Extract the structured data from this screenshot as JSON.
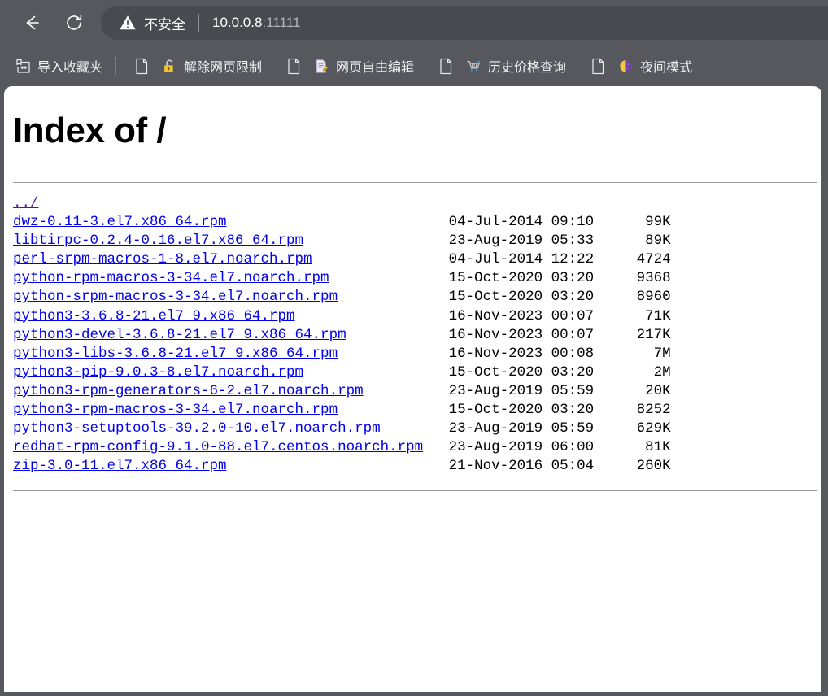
{
  "browser": {
    "back_icon": "back-arrow-icon",
    "reload_icon": "reload-icon",
    "omnibox": {
      "warning_icon": "warning-triangle-icon",
      "security_label": "不安全",
      "url_host": "10.0.0.8",
      "url_rest": ":11111",
      "full_url": "10.0.0.8:11111"
    },
    "bookmarks": [
      {
        "icon": "import-bookmarks-icon",
        "label": "导入收藏夹"
      },
      {
        "icon": "unlock-icon",
        "label": "解除网页限制"
      },
      {
        "icon": "edit-document-icon",
        "label": "网页自由编辑"
      },
      {
        "icon": "shopping-cart-icon",
        "label": "历史价格查询"
      },
      {
        "icon": "moon-icon",
        "label": "夜间模式"
      }
    ]
  },
  "page": {
    "title": "Index of /",
    "parent_link": "../",
    "entries": [
      {
        "name": "dwz-0.11-3.el7.x86_64.rpm",
        "date": "04-Jul-2014 09:10",
        "size": "99K"
      },
      {
        "name": "libtirpc-0.2.4-0.16.el7.x86_64.rpm",
        "date": "23-Aug-2019 05:33",
        "size": "89K"
      },
      {
        "name": "perl-srpm-macros-1-8.el7.noarch.rpm",
        "date": "04-Jul-2014 12:22",
        "size": "4724"
      },
      {
        "name": "python-rpm-macros-3-34.el7.noarch.rpm",
        "date": "15-Oct-2020 03:20",
        "size": "9368"
      },
      {
        "name": "python-srpm-macros-3-34.el7.noarch.rpm",
        "date": "15-Oct-2020 03:20",
        "size": "8960"
      },
      {
        "name": "python3-3.6.8-21.el7_9.x86_64.rpm",
        "date": "16-Nov-2023 00:07",
        "size": "71K"
      },
      {
        "name": "python3-devel-3.6.8-21.el7_9.x86_64.rpm",
        "date": "16-Nov-2023 00:07",
        "size": "217K"
      },
      {
        "name": "python3-libs-3.6.8-21.el7_9.x86_64.rpm",
        "date": "16-Nov-2023 00:08",
        "size": "7M"
      },
      {
        "name": "python3-pip-9.0.3-8.el7.noarch.rpm",
        "date": "15-Oct-2020 03:20",
        "size": "2M"
      },
      {
        "name": "python3-rpm-generators-6-2.el7.noarch.rpm",
        "date": "23-Aug-2019 05:59",
        "size": "20K"
      },
      {
        "name": "python3-rpm-macros-3-34.el7.noarch.rpm",
        "date": "15-Oct-2020 03:20",
        "size": "8252"
      },
      {
        "name": "python3-setuptools-39.2.0-10.el7.noarch.rpm",
        "date": "23-Aug-2019 05:59",
        "size": "629K"
      },
      {
        "name": "redhat-rpm-config-9.1.0-88.el7.centos.noarch.rpm",
        "date": "23-Aug-2019 06:00",
        "size": "81K"
      },
      {
        "name": "zip-3.0-11.el7.x86_64.rpm",
        "date": "21-Nov-2016 05:04",
        "size": "260K"
      }
    ]
  },
  "colors": {
    "chrome_bg": "#57585e",
    "omnibox_bg": "#494a50",
    "link": "#0000ee",
    "visited_link": "#551a8b",
    "page_bg": "#ffffff"
  }
}
